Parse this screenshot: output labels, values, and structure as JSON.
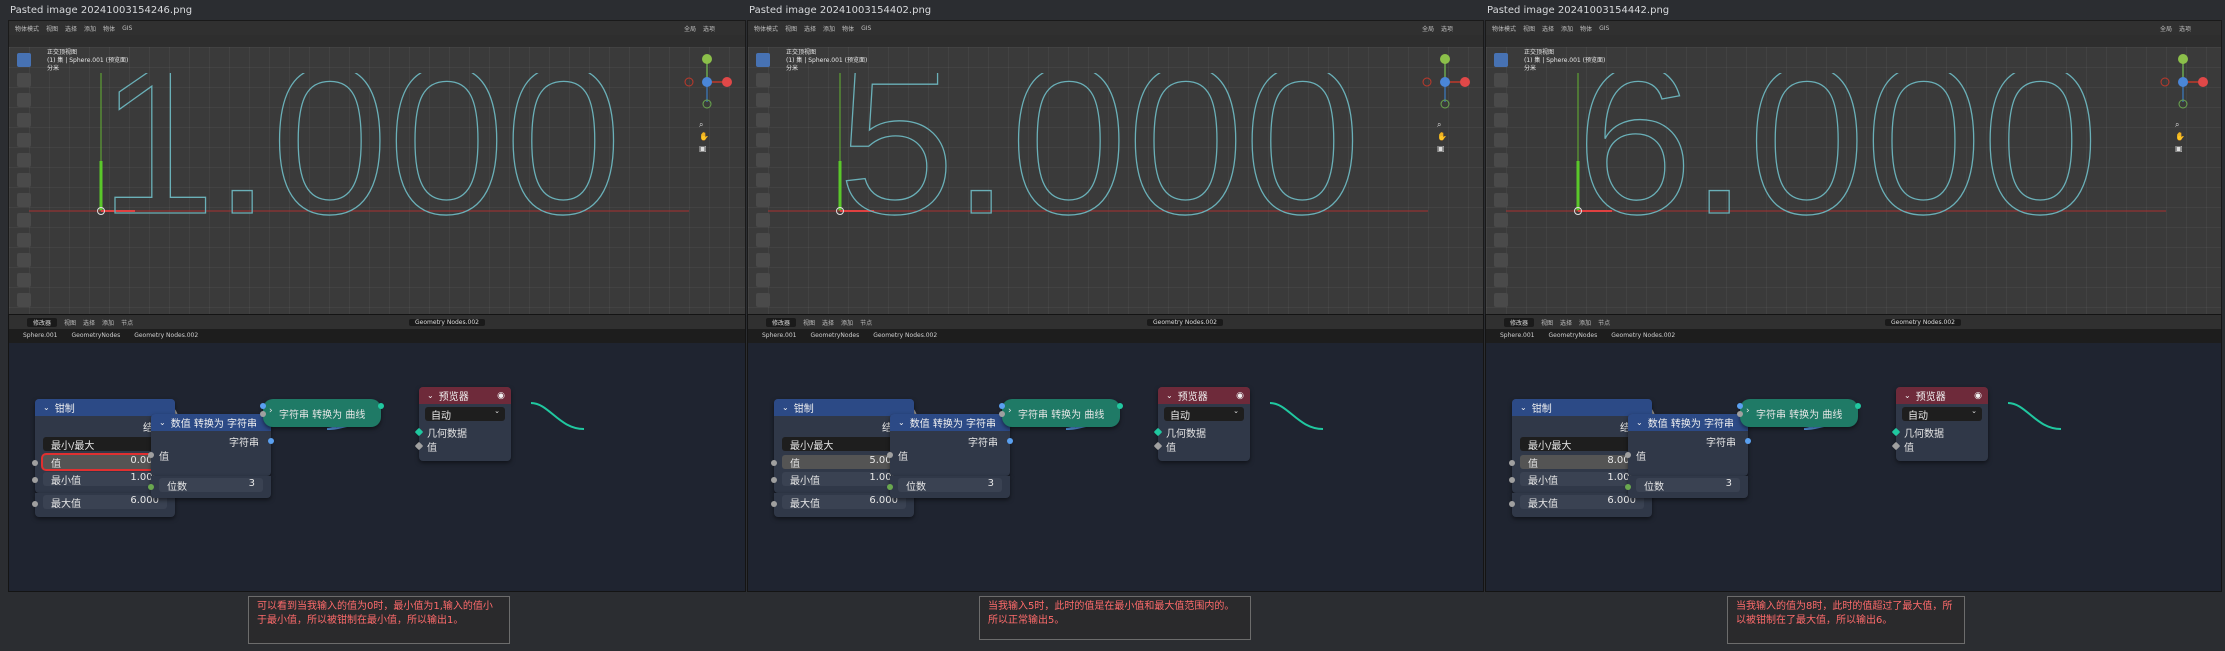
{
  "panels": [
    {
      "title": "Pasted image 20241003154246.png",
      "viewport": {
        "menu": [
          "物体模式",
          "视图",
          "选择",
          "添加",
          "物体",
          "GIS"
        ],
        "shading": "全局",
        "option": "选项",
        "info_lines": [
          "正交顶视图",
          "(1) 集 | Sphere.001 (预览面)",
          "分米"
        ],
        "display_digit": "1"
      },
      "node_editor": {
        "editor_type": "修改器",
        "menu": [
          "视图",
          "选择",
          "添加",
          "节点"
        ],
        "tree_name": "Geometry Nodes.002",
        "breadcrumbs": [
          "Sphere.001",
          "GeometryNodes",
          "Geometry Nodes.002"
        ],
        "clamp": {
          "title": "钳制",
          "result": "结果",
          "mode": "最小/最大",
          "value_label": "值",
          "value": "0.000",
          "min_label": "最小值",
          "min": "1.000",
          "max_label": "最大值",
          "max": "6.000"
        },
        "to_string": {
          "title": "数值 转换为 字符串",
          "output": "字符串",
          "input": "值",
          "decimals_label": "位数",
          "decimals": "3"
        },
        "to_curves": {
          "title": "字符串 转换为 曲线"
        },
        "viewer": {
          "title": "预览器",
          "mode": "自动",
          "geometry": "几何数据",
          "value": "值"
        }
      },
      "note": "可以看到当我输入的值为0时，最小值为1,输入的值小于最小值，所以被钳制在最小值，所以输出1。"
    },
    {
      "title": "Pasted image 20241003154402.png",
      "viewport": {
        "menu": [
          "物体模式",
          "视图",
          "选择",
          "添加",
          "物体",
          "GIS"
        ],
        "shading": "全局",
        "option": "选项",
        "info_lines": [
          "正交顶视图",
          "(1) 集 | Sphere.001 (预览面)",
          "分米"
        ],
        "display_digit": "5"
      },
      "node_editor": {
        "editor_type": "修改器",
        "menu": [
          "视图",
          "选择",
          "添加",
          "节点"
        ],
        "tree_name": "Geometry Nodes.002",
        "breadcrumbs": [
          "Sphere.001",
          "GeometryNodes",
          "Geometry Nodes.002"
        ],
        "clamp": {
          "title": "钳制",
          "result": "结果",
          "mode": "最小/最大",
          "value_label": "值",
          "value": "5.000",
          "min_label": "最小值",
          "min": "1.000",
          "max_label": "最大值",
          "max": "6.000"
        },
        "to_string": {
          "title": "数值 转换为 字符串",
          "output": "字符串",
          "input": "值",
          "decimals_label": "位数",
          "decimals": "3"
        },
        "to_curves": {
          "title": "字符串 转换为 曲线"
        },
        "viewer": {
          "title": "预览器",
          "mode": "自动",
          "geometry": "几何数据",
          "value": "值"
        }
      },
      "note": "当我输入5时，此时的值是在最小值和最大值范围内的。所以正常输出5。"
    },
    {
      "title": "Pasted image 20241003154442.png",
      "viewport": {
        "menu": [
          "物体模式",
          "视图",
          "选择",
          "添加",
          "物体",
          "GIS"
        ],
        "shading": "全局",
        "option": "选项",
        "info_lines": [
          "正交顶视图",
          "(1) 集 | Sphere.001 (预览面)",
          "分米"
        ],
        "display_digit": "6"
      },
      "node_editor": {
        "editor_type": "修改器",
        "menu": [
          "视图",
          "选择",
          "添加",
          "节点"
        ],
        "tree_name": "Geometry Nodes.002",
        "breadcrumbs": [
          "Sphere.001",
          "GeometryNodes",
          "Geometry Nodes.002"
        ],
        "clamp": {
          "title": "钳制",
          "result": "结果",
          "mode": "最小/最大",
          "value_label": "值",
          "value": "8.000",
          "min_label": "最小值",
          "min": "1.000",
          "max_label": "最大值",
          "max": "6.000"
        },
        "to_string": {
          "title": "数值 转换为 字符串",
          "output": "字符串",
          "input": "值",
          "decimals_label": "位数",
          "decimals": "3"
        },
        "to_curves": {
          "title": "字符串 转换为 曲线"
        },
        "viewer": {
          "title": "预览器",
          "mode": "自动",
          "geometry": "几何数据",
          "value": "值"
        }
      },
      "note": "当我输入的值为8时，此时的值超过了最大值，所以被钳制在了最大值，所以输出6。"
    }
  ],
  "display_suffix": ".000",
  "colors": {
    "clamp_header": "#2c4a86",
    "convert_header": "#2c4a86",
    "curves_node": "#1f7a66",
    "viewer_header": "#6e2a3a",
    "highlight": "#e03030",
    "note_text": "#ff6b6b"
  }
}
